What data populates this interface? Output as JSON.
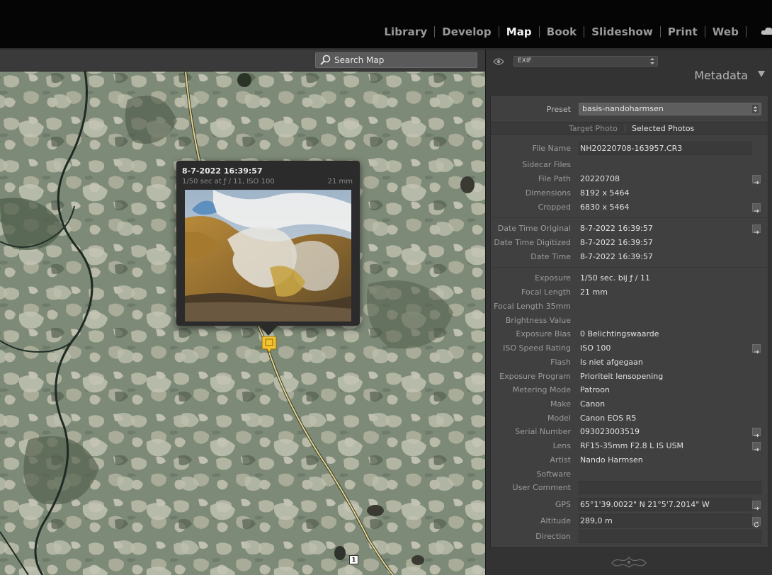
{
  "topbar": {
    "modules": [
      {
        "label": "Library",
        "active": false
      },
      {
        "label": "Develop",
        "active": false
      },
      {
        "label": "Map",
        "active": true
      },
      {
        "label": "Book",
        "active": false
      },
      {
        "label": "Slideshow",
        "active": false
      },
      {
        "label": "Print",
        "active": false
      },
      {
        "label": "Web",
        "active": false
      }
    ],
    "cloud_icon": "cloud-icon"
  },
  "map_toolbar": {
    "search_placeholder": "Search Map",
    "search_icon": "magnifier-icon"
  },
  "popup": {
    "date": "8-7-2022 16:39:57",
    "exposure": "1/50 sec at ƒ / 11, ISO 100",
    "focal": "21 mm"
  },
  "route_marker": "1",
  "colors": {
    "road": "#d9cf8a",
    "marker": "#f2c230",
    "panel_bg": "#333333"
  },
  "panel": {
    "view_select": "EXIF",
    "title": "Metadata",
    "preset_label": "Preset",
    "preset_value": "basis-nandoharmsen",
    "tabs": {
      "target": "Target Photo",
      "selected": "Selected Photos"
    },
    "rows": [
      {
        "label": "File Name",
        "value": "NH20220708-163957.CR3"
      },
      {
        "label": "Sidecar Files",
        "value": ""
      },
      {
        "label": "File Path",
        "value": "20220708"
      },
      {
        "label": "Dimensions",
        "value": "8192 x 5464"
      },
      {
        "label": "Cropped",
        "value": "6830 x 5464"
      },
      {
        "label": "Date Time Original",
        "value": "8-7-2022 16:39:57"
      },
      {
        "label": "Date Time Digitized",
        "value": "8-7-2022 16:39:57"
      },
      {
        "label": "Date Time",
        "value": "8-7-2022 16:39:57"
      },
      {
        "label": "Exposure",
        "value": "1/50 sec. bij ƒ / 11"
      },
      {
        "label": "Focal Length",
        "value": "21 mm"
      },
      {
        "label": "Focal Length 35mm",
        "value": ""
      },
      {
        "label": "Brightness Value",
        "value": ""
      },
      {
        "label": "Exposure Bias",
        "value": "0 Belichtingswaarde"
      },
      {
        "label": "ISO Speed Rating",
        "value": "ISO 100"
      },
      {
        "label": "Flash",
        "value": "Is niet afgegaan"
      },
      {
        "label": "Exposure Program",
        "value": "Prioriteit lensopening"
      },
      {
        "label": "Metering Mode",
        "value": "Patroon"
      },
      {
        "label": "Make",
        "value": "Canon"
      },
      {
        "label": "Model",
        "value": "Canon EOS R5"
      },
      {
        "label": "Serial Number",
        "value": "093023003519"
      },
      {
        "label": "Lens",
        "value": "RF15-35mm F2.8 L IS USM"
      },
      {
        "label": "Artist",
        "value": "Nando Harmsen"
      },
      {
        "label": "Software",
        "value": ""
      },
      {
        "label": "User Comment",
        "value": ""
      },
      {
        "label": "GPS",
        "value": "65°1'39.0022\" N 21°5'7.2014\" W"
      },
      {
        "label": "Altitude",
        "value": "289,0 m"
      },
      {
        "label": "Direction",
        "value": ""
      }
    ]
  }
}
